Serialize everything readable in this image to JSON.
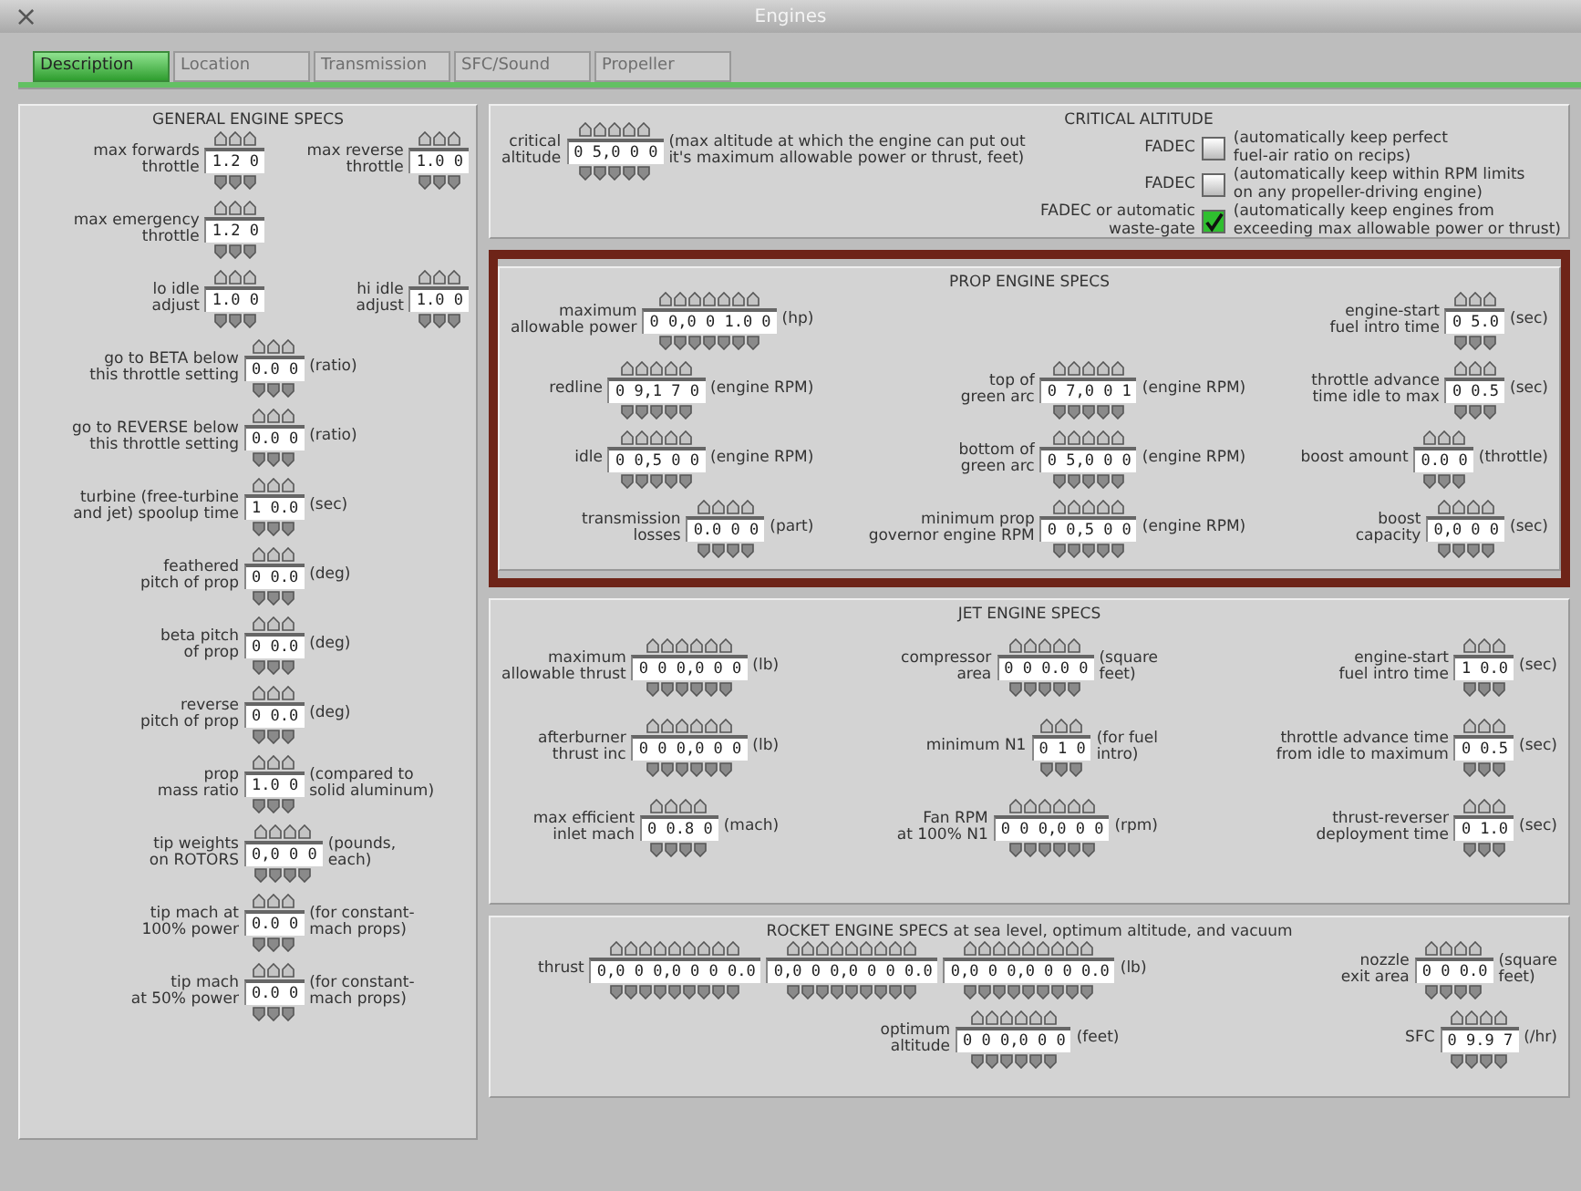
{
  "window": {
    "title": "Engines",
    "close": "×"
  },
  "tabs": [
    {
      "label": "Description",
      "selected": true
    },
    {
      "label": "Location",
      "selected": false
    },
    {
      "label": "Transmission",
      "selected": false
    },
    {
      "label": "SFC/Sound",
      "selected": false
    },
    {
      "label": "Propeller",
      "selected": false
    }
  ],
  "general": {
    "title": "GENERAL ENGINE SPECS",
    "rows": [
      [
        {
          "label": "max forwards\nthrottle",
          "values": [
            "1.2 0"
          ]
        },
        {
          "label": "max reverse\nthrottle",
          "values": [
            "1.0 0"
          ]
        }
      ],
      [
        {
          "label": "max emergency\nthrottle",
          "values": [
            "1.2 0"
          ]
        }
      ],
      [
        {
          "label": "lo idle\nadjust",
          "values": [
            "1.0 0"
          ]
        },
        {
          "label": "hi idle\nadjust",
          "values": [
            "1.0 0"
          ]
        }
      ],
      [
        {
          "label": "go to BETA below\nthis throttle setting",
          "values": [
            "0.0 0"
          ],
          "unit": "(ratio)"
        }
      ],
      [
        {
          "label": "go to REVERSE below\nthis throttle setting",
          "values": [
            "0.0 0"
          ],
          "unit": "(ratio)"
        }
      ],
      [
        {
          "label": "turbine (free-turbine\nand jet) spoolup time",
          "values": [
            "1 0.0"
          ],
          "unit": "(sec)"
        }
      ],
      [
        {
          "label": "feathered\npitch of prop",
          "values": [
            "0 0.0"
          ],
          "unit": "(deg)"
        }
      ],
      [
        {
          "label": "beta pitch\nof prop",
          "values": [
            "0 0.0"
          ],
          "unit": "(deg)"
        }
      ],
      [
        {
          "label": "reverse\npitch of prop",
          "values": [
            "0 0.0"
          ],
          "unit": "(deg)"
        }
      ],
      [
        {
          "label": "prop\nmass ratio",
          "values": [
            "1.0 0"
          ],
          "unit": "(compared to\nsolid aluminum)"
        }
      ],
      [
        {
          "label": "tip weights\non ROTORS",
          "values": [
            "0,0 0 0"
          ],
          "unit": "(pounds,\neach)"
        }
      ],
      [
        {
          "label": "tip mach at\n100% power",
          "values": [
            "0.0 0"
          ],
          "unit": "(for constant-\nmach props)"
        }
      ],
      [
        {
          "label": "tip mach\nat 50% power",
          "values": [
            "0.0 0"
          ],
          "unit": "(for constant-\nmach props)"
        }
      ]
    ]
  },
  "critical": {
    "title": "CRITICAL ALTITUDE",
    "field": {
      "label": "critical\naltitude",
      "values": [
        "0 5,0 0 0"
      ],
      "unit": "(max altitude at which the engine can put out\nit's maximum allowable power or thrust, feet)"
    },
    "options": [
      {
        "label": "FADEC",
        "checked": false,
        "description": "(automatically keep perfect\nfuel-air ratio on recips)"
      },
      {
        "label": "FADEC",
        "checked": false,
        "description": "(automatically keep within RPM limits\non any propeller-driving engine)"
      },
      {
        "label": "FADEC or automatic\nwaste-gate",
        "checked": true,
        "description": "(automatically keep engines from\nexceeding max allowable power or thrust)"
      }
    ]
  },
  "prop": {
    "title": "PROP ENGINE SPECS",
    "highlighted": true,
    "rows": [
      [
        {
          "label": "maximum\nallowable power",
          "values": [
            "0 0,0 0 1.0 0"
          ],
          "unit": "(hp)"
        },
        "",
        {
          "label": "engine-start\nfuel intro time",
          "values": [
            "0 5.0"
          ],
          "unit": "(sec)"
        }
      ],
      [
        {
          "label": "redline",
          "values": [
            "0 9,1 7 0"
          ],
          "unit": "(engine RPM)"
        },
        {
          "label": "top of\ngreen arc",
          "values": [
            "0 7,0 0 1"
          ],
          "unit": "(engine RPM)"
        },
        {
          "label": "throttle advance\ntime idle to max",
          "values": [
            "0 0.5"
          ],
          "unit": "(sec)"
        }
      ],
      [
        {
          "label": "idle",
          "values": [
            "0 0,5 0 0"
          ],
          "unit": "(engine RPM)"
        },
        {
          "label": "bottom of\ngreen arc",
          "values": [
            "0 5,0 0 0"
          ],
          "unit": "(engine RPM)"
        },
        {
          "label": "boost amount",
          "values": [
            "0.0 0"
          ],
          "unit": "(throttle)"
        }
      ],
      [
        {
          "label": "transmission\nlosses",
          "values": [
            "0.0 0 0"
          ],
          "unit": "(part)"
        },
        {
          "label": "minimum prop\ngovernor engine RPM",
          "values": [
            "0 0,5 0 0"
          ],
          "unit": "(engine RPM)"
        },
        {
          "label": "boost\ncapacity",
          "values": [
            "0,0 0 0"
          ],
          "unit": "(sec)"
        }
      ]
    ]
  },
  "jet": {
    "title": "JET ENGINE SPECS",
    "highlighted": false,
    "rows": [
      [
        {
          "label": "maximum\nallowable thrust",
          "values": [
            "0 0 0,0 0 0"
          ],
          "unit": "(lb)"
        },
        {
          "label": "compressor\narea",
          "values": [
            "0 0 0.0 0"
          ],
          "unit": "(square\nfeet)"
        },
        {
          "label": "engine-start\nfuel intro time",
          "values": [
            "1 0.0"
          ],
          "unit": "(sec)"
        }
      ],
      [
        {
          "label": "afterburner\nthrust inc",
          "values": [
            "0 0 0,0 0 0"
          ],
          "unit": "(lb)"
        },
        {
          "label": "minimum N1",
          "values": [
            "0 1 0"
          ],
          "unit": "(for fuel\nintro)"
        },
        {
          "label": "throttle advance time\nfrom idle to maximum",
          "values": [
            "0 0.5"
          ],
          "unit": "(sec)"
        }
      ],
      [
        {
          "label": "max efficient\ninlet mach",
          "values": [
            "0 0.8 0"
          ],
          "unit": "(mach)"
        },
        {
          "label": "Fan RPM\nat 100% N1",
          "values": [
            "0 0 0,0 0 0"
          ],
          "unit": "(rpm)"
        },
        {
          "label": "thrust-reverser\ndeployment time",
          "values": [
            "0 1.0"
          ],
          "unit": "(sec)"
        }
      ]
    ]
  },
  "rocket": {
    "title": "ROCKET ENGINE SPECS at sea level, optimum altitude, and vacuum",
    "highlighted": false,
    "rows": [
      [
        {
          "label": "thrust",
          "values": [
            "0,0 0 0,0 0 0 0.0",
            "0,0 0 0,0 0 0 0.0",
            "0,0 0 0,0 0 0 0.0"
          ],
          "unit": "(lb)"
        },
        "",
        {
          "label": "nozzle\nexit area",
          "values": [
            "0 0 0.0"
          ],
          "unit": "(square\nfeet)"
        }
      ],
      [
        "",
        {
          "label": "optimum\naltitude",
          "values": [
            "0 0 0,0 0 0"
          ],
          "unit": "(feet)"
        },
        {
          "label": "SFC",
          "values": [
            "0 9.9 7"
          ],
          "unit": "(/hr)"
        }
      ]
    ]
  }
}
